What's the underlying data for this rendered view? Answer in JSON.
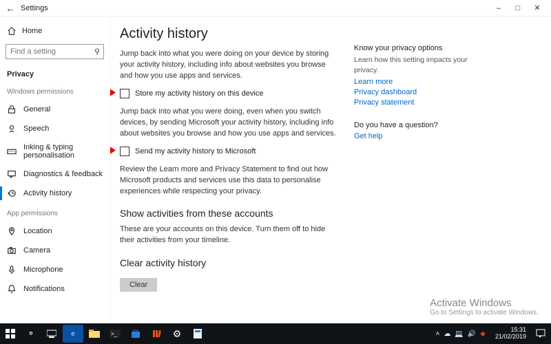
{
  "window": {
    "title": "Settings"
  },
  "sidebar": {
    "home": "Home",
    "search_placeholder": "Find a setting",
    "current": "Privacy",
    "section_windows": "Windows permissions",
    "section_app": "App permissions",
    "items_windows": [
      {
        "icon": "lock",
        "label": "General"
      },
      {
        "icon": "mic-speech",
        "label": "Speech"
      },
      {
        "icon": "keyboard",
        "label": "Inking & typing personalisation"
      },
      {
        "icon": "diag",
        "label": "Diagnostics & feedback"
      },
      {
        "icon": "history",
        "label": "Activity history",
        "active": true
      }
    ],
    "items_app": [
      {
        "icon": "location",
        "label": "Location"
      },
      {
        "icon": "camera",
        "label": "Camera"
      },
      {
        "icon": "microphone",
        "label": "Microphone"
      },
      {
        "icon": "bell",
        "label": "Notifications"
      }
    ]
  },
  "main": {
    "title": "Activity history",
    "para1": "Jump back into what you were doing on your device by storing your activity history, including info about websites you browse and how you use apps and services.",
    "check1": "Store my activity history on this device",
    "para2": "Jump back into what you were doing, even when you switch devices, by sending Microsoft your activity history, including info about websites you browse and how you use apps and services.",
    "check2": "Send my activity history to Microsoft",
    "para3": "Review the Learn more and Privacy Statement to find out how Microsoft products and services use this data to personalise experiences while respecting your privacy.",
    "heading_accounts": "Show activities from these accounts",
    "para_accounts": "These are your accounts on this device. Turn them off to hide their activities from your timeline.",
    "heading_clear": "Clear activity history",
    "clear": "Clear"
  },
  "right": {
    "h1": "Know your privacy options",
    "t1": "Learn how this setting impacts your privacy.",
    "link1": "Learn more",
    "link2": "Privacy dashboard",
    "link3": "Privacy statement",
    "h2": "Do you have a question?",
    "link4": "Get help"
  },
  "watermark": {
    "t1": "Activate Windows",
    "t2": "Go to Settings to activate Windows."
  },
  "taskbar": {
    "time": "15:31",
    "date": "21/02/2019"
  }
}
